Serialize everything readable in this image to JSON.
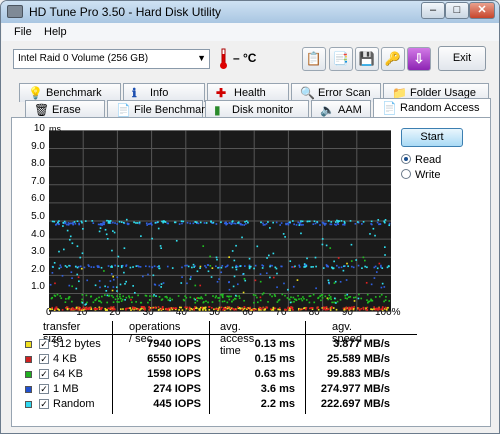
{
  "window": {
    "title": "HD Tune Pro 3.50 - Hard Disk Utility",
    "minimize": "–",
    "maximize": "□",
    "close": "✕"
  },
  "menu": [
    {
      "label": "File"
    },
    {
      "label": "Help"
    }
  ],
  "toolbar": {
    "drive": "Intel  Raid 0 Volume (256 GB)",
    "temperature": "– °C",
    "exit_label": "Exit"
  },
  "tabs_row1": [
    {
      "label": "Benchmark",
      "icon": "benchmark-icon"
    },
    {
      "label": "Info",
      "icon": "info-icon"
    },
    {
      "label": "Health",
      "icon": "health-icon"
    },
    {
      "label": "Error Scan",
      "icon": "error-scan-icon"
    },
    {
      "label": "Folder Usage",
      "icon": "folder-icon"
    }
  ],
  "tabs_row2": [
    {
      "label": "Erase",
      "icon": "erase-icon"
    },
    {
      "label": "File Benchmark",
      "icon": "file-benchmark-icon"
    },
    {
      "label": "Disk monitor",
      "icon": "disk-monitor-icon"
    },
    {
      "label": "AAM",
      "icon": "aam-icon"
    },
    {
      "label": "Random Access",
      "icon": "random-access-icon",
      "active": true
    }
  ],
  "chart_data": {
    "type": "scatter",
    "ylabel": "ms",
    "ylim": [
      0,
      10
    ],
    "yticks": [
      "10",
      "9.0",
      "8.0",
      "7.0",
      "6.0",
      "5.0",
      "4.0",
      "3.0",
      "2.0",
      "1.0"
    ],
    "xlim": [
      0,
      100
    ],
    "xticks": [
      "0",
      "10",
      "20",
      "30",
      "40",
      "50",
      "60",
      "70",
      "80",
      "90",
      "100%"
    ],
    "grid": true,
    "series": [
      {
        "name": "512 bytes",
        "color": "#f0e020",
        "band": 0.13
      },
      {
        "name": "4 KB",
        "color": "#e02020",
        "band": 0.15
      },
      {
        "name": "64 KB",
        "color": "#20c020",
        "band": 0.63
      },
      {
        "name": "1 MB",
        "color": "#3060e0",
        "band": 3.6
      },
      {
        "name": "Random",
        "color": "#30e0f0",
        "band": 2.2
      }
    ]
  },
  "controls": {
    "start": "Start",
    "read": "Read",
    "write": "Write"
  },
  "results": {
    "headers": [
      "transfer size",
      "operations / sec",
      "avg. access time",
      "agv. speed"
    ],
    "rows": [
      {
        "size": "512 bytes",
        "color": "#f0e020",
        "ops": "7940 IOPS",
        "time": "0.13 ms",
        "speed": "3.877 MB/s"
      },
      {
        "size": "4 KB",
        "color": "#d02020",
        "ops": "6550 IOPS",
        "time": "0.15 ms",
        "speed": "25.589 MB/s"
      },
      {
        "size": "64 KB",
        "color": "#20b020",
        "ops": "1598 IOPS",
        "time": "0.63 ms",
        "speed": "99.883 MB/s"
      },
      {
        "size": "1 MB",
        "color": "#2050d0",
        "ops": "274 IOPS",
        "time": "3.6 ms",
        "speed": "274.977 MB/s"
      },
      {
        "size": "Random",
        "color": "#30d8f0",
        "ops": "445 IOPS",
        "time": "2.2 ms",
        "speed": "222.697 MB/s"
      }
    ]
  }
}
